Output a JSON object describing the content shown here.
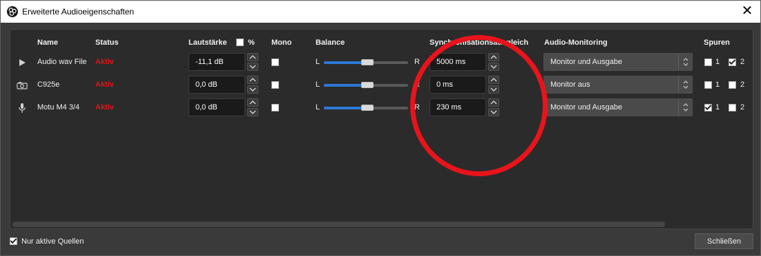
{
  "window": {
    "title": "Erweiterte Audioeigenschaften",
    "close_glyph": "✕"
  },
  "columns": {
    "name": "Name",
    "status": "Status",
    "volume": "Lautstärke",
    "percent": "%",
    "mono": "Mono",
    "balance": "Balance",
    "sync": "Synchronisationsausgleich",
    "monitoring": "Audio-Monitoring",
    "tracks": "Spuren"
  },
  "balance_left": "L",
  "balance_right": "R",
  "accent_color": "#2b79d6",
  "status_color": "#e0161c",
  "annotation_color": "#e8141b",
  "rows": [
    {
      "icon": "play-icon",
      "name": "Audio wav File",
      "status": "Aktiv",
      "volume": "-11,1 dB",
      "mono": false,
      "balance": 0.5,
      "sync": "5000 ms",
      "monitoring": "Monitor und Ausgabe",
      "track1_label": "1",
      "track1": false,
      "track2_label": "2",
      "track2": true
    },
    {
      "icon": "camera-icon",
      "name": "C925e",
      "status": "Aktiv",
      "volume": "0,0 dB",
      "mono": false,
      "balance": 0.5,
      "sync": "0 ms",
      "monitoring": "Monitor aus",
      "track1_label": "1",
      "track1": false,
      "track2_label": "2",
      "track2": false
    },
    {
      "icon": "microphone-icon",
      "name": "Motu M4 3/4",
      "status": "Aktiv",
      "volume": "0,0 dB",
      "mono": false,
      "balance": 0.5,
      "sync": "230 ms",
      "monitoring": "Monitor und Ausgabe",
      "track1_label": "1",
      "track1": true,
      "track2_label": "2",
      "track2": false
    }
  ],
  "footer": {
    "only_active_label": "Nur aktive Quellen",
    "only_active_checked": true,
    "close_label": "Schließen"
  }
}
